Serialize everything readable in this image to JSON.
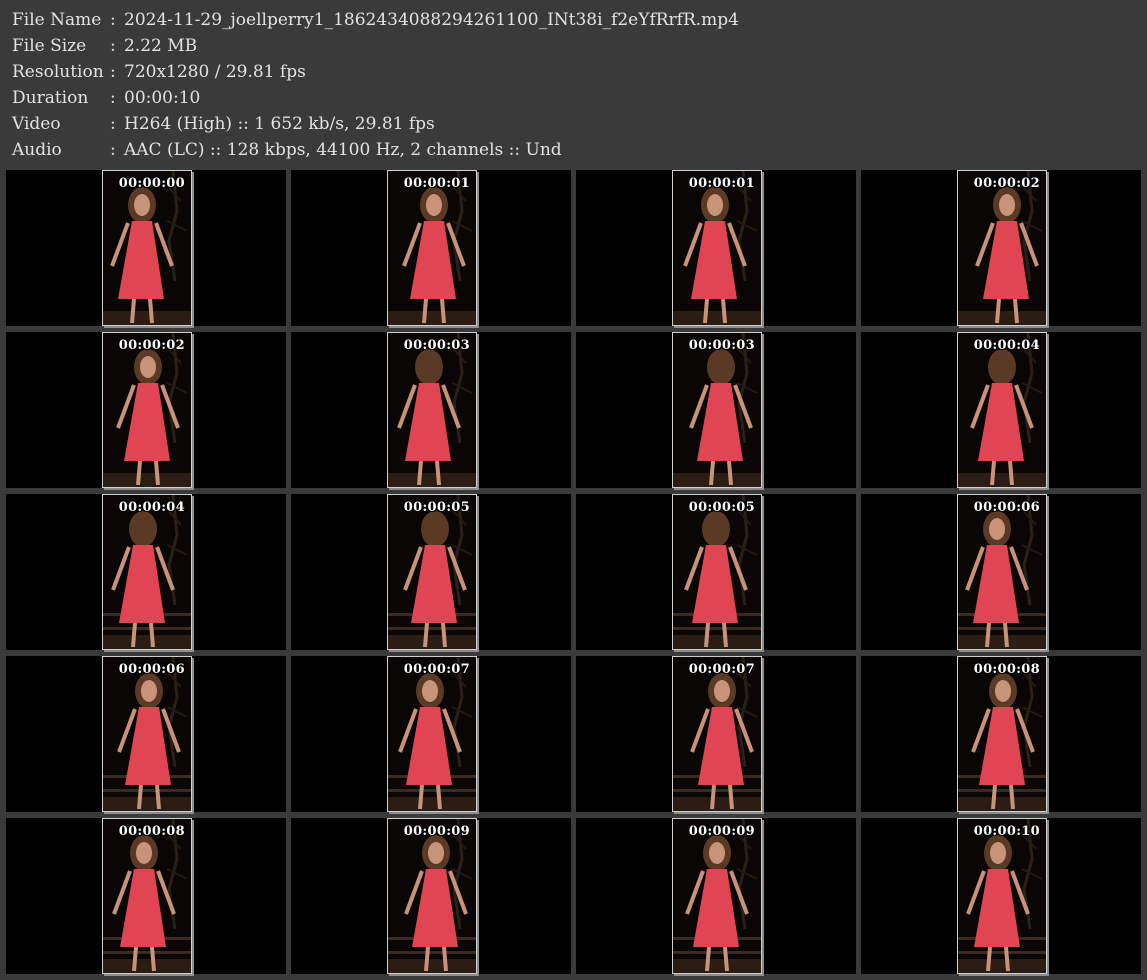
{
  "info": {
    "rows": [
      {
        "label": "File Name",
        "value": "2024-11-29_joellperry1_1862434088294261100_INt38i_f2eYfRrfR.mp4"
      },
      {
        "label": "File Size",
        "value": "2.22 MB"
      },
      {
        "label": "Resolution",
        "value": "720x1280 / 29.81 fps"
      },
      {
        "label": "Duration",
        "value": "00:00:10"
      },
      {
        "label": "Video",
        "value": "H264 (High) :: 1 652 kb/s, 29.81 fps"
      },
      {
        "label": "Audio",
        "value": "AAC (LC) :: 128 kbps, 44100 Hz, 2 channels :: Und"
      }
    ],
    "colon": ":"
  },
  "frames": [
    "00:00:00",
    "00:00:01",
    "00:00:01",
    "00:00:02",
    "00:00:02",
    "00:00:03",
    "00:00:03",
    "00:00:04",
    "00:00:04",
    "00:00:05",
    "00:00:05",
    "00:00:06",
    "00:00:06",
    "00:00:07",
    "00:00:07",
    "00:00:08",
    "00:00:08",
    "00:00:09",
    "00:00:09",
    "00:00:10"
  ],
  "colors": {
    "background": "#3a3a3a",
    "text": "#e2e2e2",
    "cell": "#000000",
    "dress": "#e04553",
    "skin": "#c9937a",
    "hair": "#5a3a24"
  }
}
